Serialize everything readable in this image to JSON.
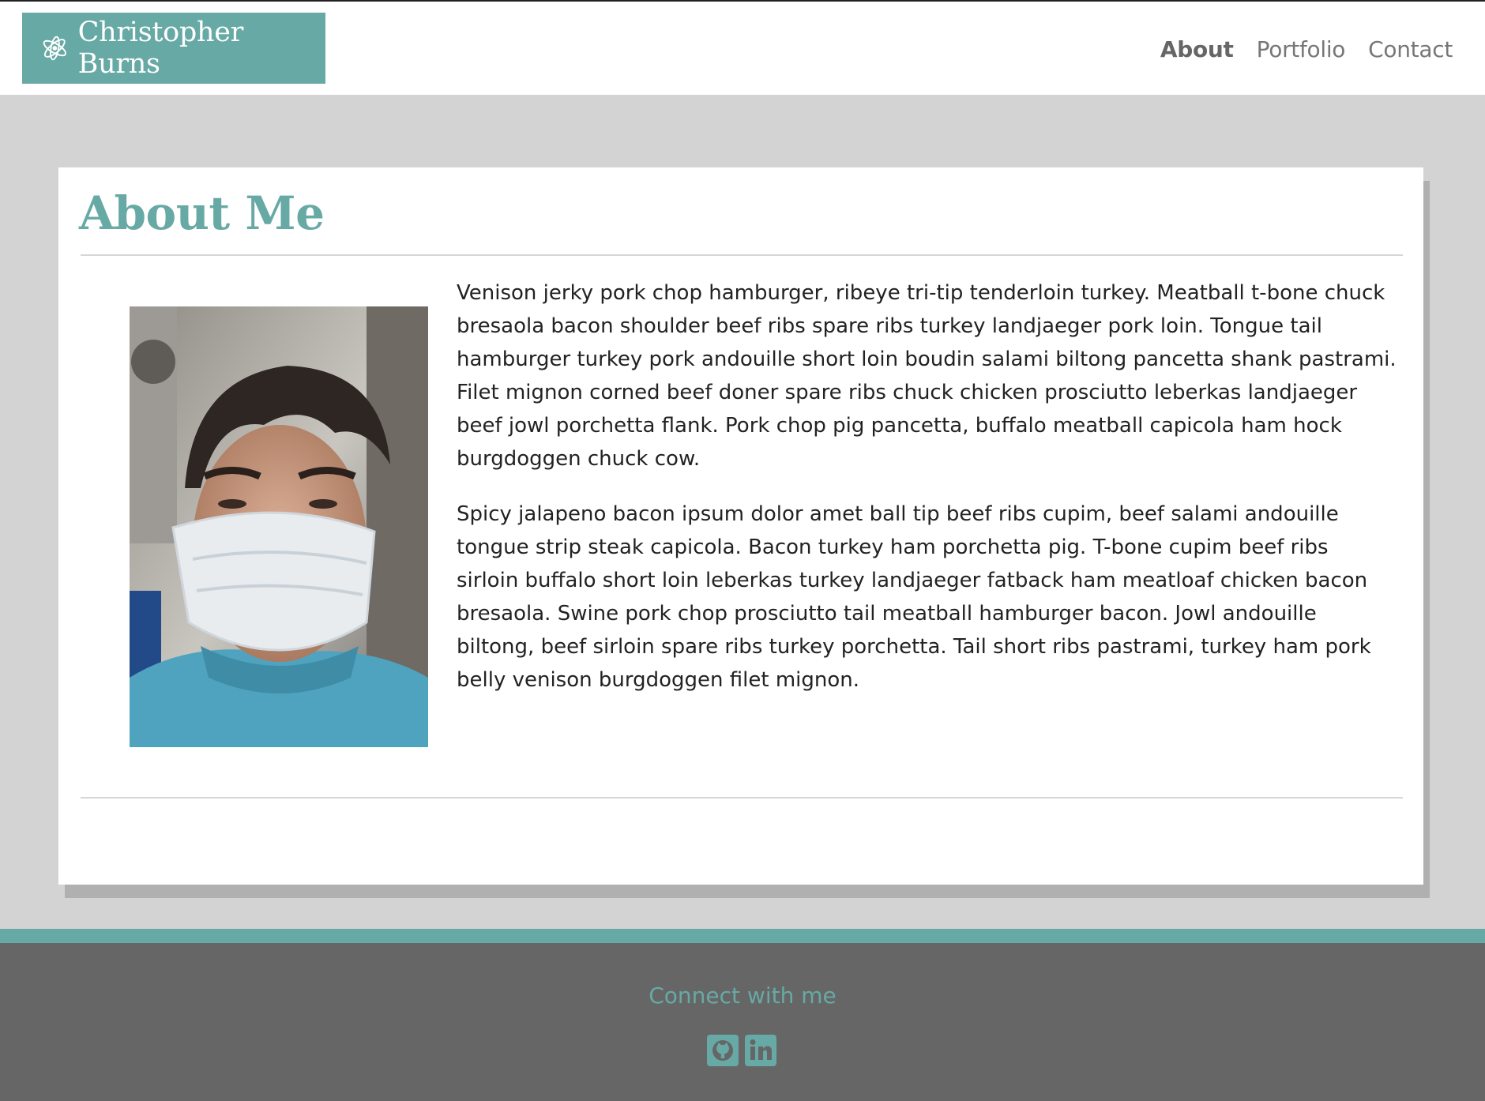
{
  "header": {
    "brand_name": "Christopher Burns",
    "brand_icon": "atom-icon",
    "nav": [
      {
        "label": "About",
        "active": true
      },
      {
        "label": "Portfolio",
        "active": false
      },
      {
        "label": "Contact",
        "active": false
      }
    ]
  },
  "main": {
    "title": "About Me",
    "paragraphs": [
      "Venison jerky pork chop hamburger, ribeye tri-tip tenderloin turkey. Meatball t-bone chuck bresaola bacon shoulder beef ribs spare ribs turkey landjaeger pork loin. Tongue tail hamburger turkey pork andouille short loin boudin salami biltong pancetta shank pastrami. Filet mignon corned beef doner spare ribs chuck chicken prosciutto leberkas landjaeger beef jowl porchetta flank. Pork chop pig pancetta, buffalo meatball capicola ham hock burgdoggen chuck cow.",
      "Spicy jalapeno bacon ipsum dolor amet ball tip beef ribs cupim, beef salami andouille tongue strip steak capicola. Bacon turkey ham porchetta pig. T-bone cupim beef ribs sirloin buffalo short loin leberkas turkey landjaeger fatback ham meatloaf chicken bacon bresaola. Swine pork chop prosciutto tail meatball hamburger bacon. Jowl andouille biltong, beef sirloin spare ribs turkey porchetta. Tail short ribs pastrami, turkey ham pork belly venison burgdoggen filet mignon."
    ]
  },
  "footer": {
    "connect_label": "Connect with me",
    "social_icons": [
      "github-icon",
      "linkedin-icon"
    ]
  },
  "colors": {
    "accent": "#67a9a5",
    "footer_bg": "#666666",
    "page_bg": "#d3d3d3"
  }
}
